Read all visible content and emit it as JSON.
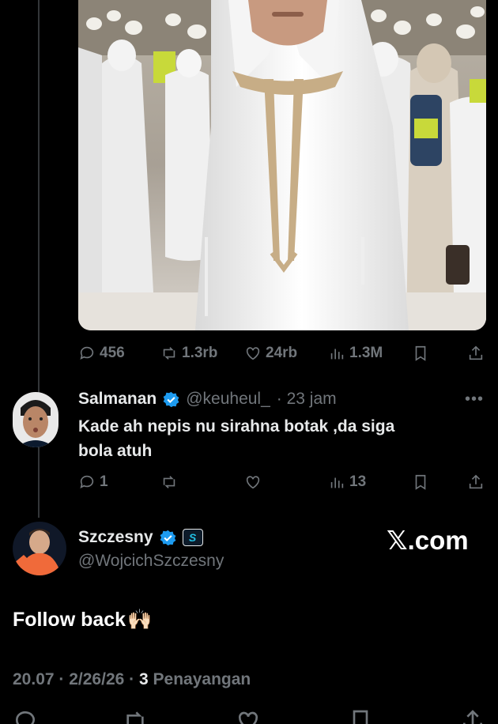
{
  "main_tweet": {
    "stats": {
      "replies": "456",
      "reposts": "1.3rb",
      "likes": "24rb",
      "views": "1.3M"
    }
  },
  "reply": {
    "name": "Salmanan",
    "handle": "@keuheul_",
    "time": "· 23 jam",
    "text_line1": "Kade ah nepis nu sirahna botak ,da siga",
    "text_line2": "bola atuh",
    "stats": {
      "replies": "1",
      "reposts": "",
      "likes": "",
      "views": "13"
    }
  },
  "focused_tweet": {
    "name": "Szczesny",
    "handle": "@WojcichSzczesny",
    "badge_letter": "S",
    "text": "Follow back",
    "emoji": "🙌🏻",
    "time": "20.07",
    "date": "2/26/26",
    "view_count": "3",
    "view_label": "Penayangan"
  },
  "watermark": "𝕏.com",
  "colors": {
    "background": "#000000",
    "muted": "#71767b",
    "verified": "#1d9bf0",
    "text": "#e7e9ea"
  },
  "icons": [
    "reply-icon",
    "repost-icon",
    "like-icon",
    "views-icon",
    "bookmark-icon",
    "share-icon",
    "verified-icon"
  ]
}
